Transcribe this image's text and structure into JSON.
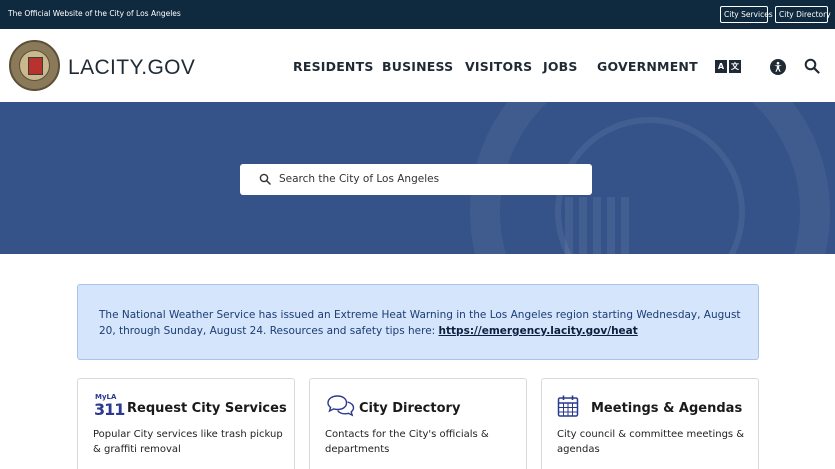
{
  "topbar": {
    "official_text": "The Official Website of the City of Los Angeles",
    "city_services": "City Services",
    "city_directory": "City Directory"
  },
  "header": {
    "logo_text": "LACITY.GOV",
    "nav": [
      "RESIDENTS",
      "BUSINESS",
      "VISITORS",
      "JOBS",
      "GOVERNMENT"
    ],
    "translate_glyphs": [
      "A",
      "文"
    ]
  },
  "hero": {
    "search_placeholder": "Search the City of Los Angeles"
  },
  "alert": {
    "text": "The National Weather Service has issued an Extreme Heat Warning in the Los Angeles region starting Wednesday, August 20, through Sunday, August 24. Resources and safety tips here: ",
    "link": "https://emergency.lacity.gov/heat"
  },
  "cards": [
    {
      "icon": "myla-311-logo",
      "logo_small": "MyLA",
      "logo_big": "311",
      "title": "Request City Services",
      "desc": "Popular City services like trash pickup & graffiti removal"
    },
    {
      "icon": "chat-bubbles-icon",
      "title": "City Directory",
      "desc": "Contacts for the City's officials & departments"
    },
    {
      "icon": "calendar-icon",
      "title": "Meetings & Agendas",
      "desc": "City council & committee meetings & agendas"
    }
  ],
  "colors": {
    "topbar": "#0f2a3f",
    "hero": "#355289",
    "alert_bg": "#d4e5fc",
    "alert_text": "#1c3c73",
    "accent": "#2b3a8f"
  }
}
